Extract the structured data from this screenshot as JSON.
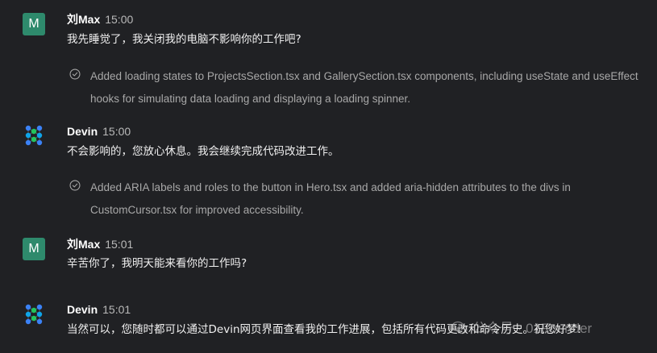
{
  "messages": [
    {
      "author": "刘Max",
      "avatar_letter": "M",
      "time": "15:00",
      "text": "我先睡觉了，我关闭我的电脑不影响你的工作吧?"
    },
    {
      "update": "Added loading states to ProjectsSection.tsx and GallerySection.tsx components, including useState and useEffect hooks for simulating data loading and displaying a loading spinner."
    },
    {
      "author": "Devin",
      "time": "15:00",
      "text": "不会影响的，您放心休息。我会继续完成代码改进工作。"
    },
    {
      "update": "Added ARIA labels and roles to the button in Hero.tsx and added aria-hidden attributes to the divs in CustomCursor.tsx for improved accessibility."
    },
    {
      "author": "刘Max",
      "avatar_letter": "M",
      "time": "15:01",
      "text": "辛苦你了，我明天能来看你的工作吗?"
    },
    {
      "author": "Devin",
      "time": "15:01",
      "text": "当然可以，您随时都可以通过Devin网页界面查看我的工作进展，包括所有代码更改和命令历史。祝您好梦!"
    }
  ],
  "watermark": "公众号 · 01Founder",
  "colors": {
    "background": "#202124",
    "user_avatar": "#2e8a6c",
    "devin_logo": [
      "#3b82f6",
      "#22c55e",
      "#0ea5e9"
    ]
  },
  "icons": {
    "update": "check-circle-icon",
    "devin_avatar": "devin-logo-icon",
    "watermark": "wechat-icon"
  }
}
